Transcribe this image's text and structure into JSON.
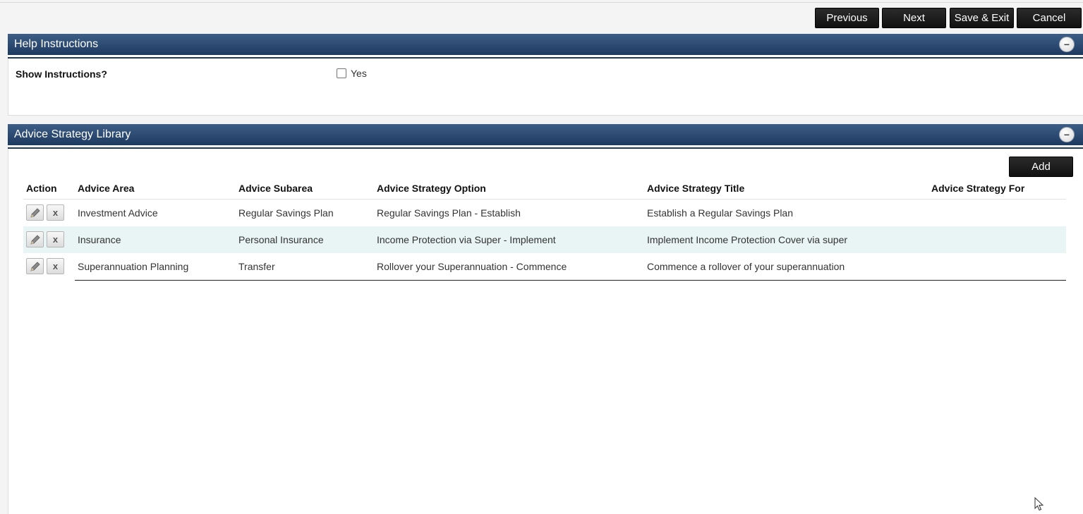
{
  "toolbar": {
    "previous_label": "Previous",
    "next_label": "Next",
    "save_exit_label": "Save & Exit",
    "cancel_label": "Cancel"
  },
  "help_panel": {
    "title": "Help Instructions",
    "collapse_glyph": "−",
    "show_instructions_label": "Show Instructions?",
    "yes_label": "Yes",
    "checked": false
  },
  "library_panel": {
    "title": "Advice Strategy Library",
    "collapse_glyph": "−",
    "add_label": "Add",
    "columns": [
      "Action",
      "Advice Area",
      "Advice Subarea",
      "Advice Strategy Option",
      "Advice Strategy Title",
      "Advice Strategy For"
    ],
    "rows": [
      {
        "area": "Investment Advice",
        "subarea": "Regular Savings Plan",
        "option": "Regular Savings Plan - Establish",
        "title": "Establish a Regular Savings Plan",
        "for": ""
      },
      {
        "area": "Insurance",
        "subarea": "Personal Insurance",
        "option": "Income Protection via Super - Implement",
        "title": "Implement Income Protection Cover via super",
        "for": ""
      },
      {
        "area": "Superannuation Planning",
        "subarea": "Transfer",
        "option": "Rollover your Superannuation - Commence",
        "title": "Commence a rollover of your superannuation",
        "for": ""
      }
    ],
    "delete_glyph": "x",
    "icons": {
      "edit": "pencil-icon",
      "delete": "close-icon"
    }
  },
  "colors": {
    "header_blue": "#1d3a60",
    "button_black": "#111111",
    "row_highlight": "#e9f4f4"
  }
}
